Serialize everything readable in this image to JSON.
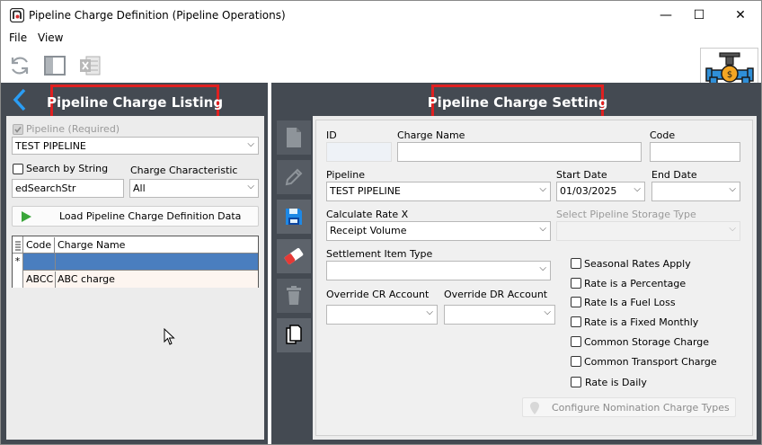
{
  "window": {
    "title": "Pipeline Charge Definition (Pipeline Operations)",
    "minimize": "—",
    "maximize": "☐",
    "close": "✕"
  },
  "menu": [
    "File",
    "View"
  ],
  "left": {
    "header": "Pipeline Charge Listing",
    "pipeline_label": "Pipeline (Required)",
    "pipeline_value": "TEST PIPELINE",
    "search_by_string_label": "Search by String",
    "search_input_value": "edSearchStr",
    "charge_char_label": "Charge Characteristic",
    "charge_char_value": "All",
    "load_button": "Load Pipeline Charge Definition Data",
    "grid": {
      "columns": [
        "Code",
        "Charge Name"
      ],
      "new_row_marker": "*",
      "rows": [
        {
          "code": "ABCC",
          "name": "ABC charge"
        }
      ]
    }
  },
  "right": {
    "header": "Pipeline Charge Setting",
    "id_label": "ID",
    "id_value": "",
    "charge_name_label": "Charge Name",
    "charge_name_value": "",
    "code_label": "Code",
    "code_value": "",
    "pipeline_label": "Pipeline",
    "pipeline_value": "TEST PIPELINE",
    "start_date_label": "Start Date",
    "start_date_value": "01/03/2025",
    "end_date_label": "End Date",
    "end_date_value": "",
    "calc_rate_label": "Calculate Rate X",
    "calc_rate_value": "Receipt Volume",
    "storage_type_label": "Select Pipeline Storage Type",
    "storage_type_value": "",
    "settlement_label": "Settlement Item Type",
    "settlement_value": "",
    "override_cr_label": "Override CR Account",
    "override_cr_value": "",
    "override_dr_label": "Override DR Account",
    "override_dr_value": "",
    "checkboxes": [
      {
        "label": "Seasonal Rates Apply",
        "checked": false
      },
      {
        "label": "Rate is a Percentage",
        "checked": false
      },
      {
        "label": "Rate Is a Fuel Loss",
        "checked": false
      },
      {
        "label": "Rate is a Fixed Monthly",
        "checked": false
      },
      {
        "label": "Common Storage Charge",
        "checked": false
      },
      {
        "label": "Common Transport Charge",
        "checked": false
      },
      {
        "label": "Rate is Daily",
        "checked": false
      }
    ],
    "configure_button": "Configure Nomination Charge Types"
  },
  "colors": {
    "panel_bg": "#444a52",
    "header_border": "#e02020",
    "selected_row": "#4a7ebf",
    "accent_blue": "#1e88e5"
  },
  "icons": [
    "app-logo-icon",
    "refresh-icon",
    "layout-icon",
    "excel-icon",
    "pipeline-valve-icon",
    "back-arrow-icon",
    "new-document-icon",
    "edit-pencil-icon",
    "save-disk-icon",
    "eraser-icon",
    "trash-icon",
    "copy-icon",
    "play-icon",
    "pin-icon"
  ]
}
